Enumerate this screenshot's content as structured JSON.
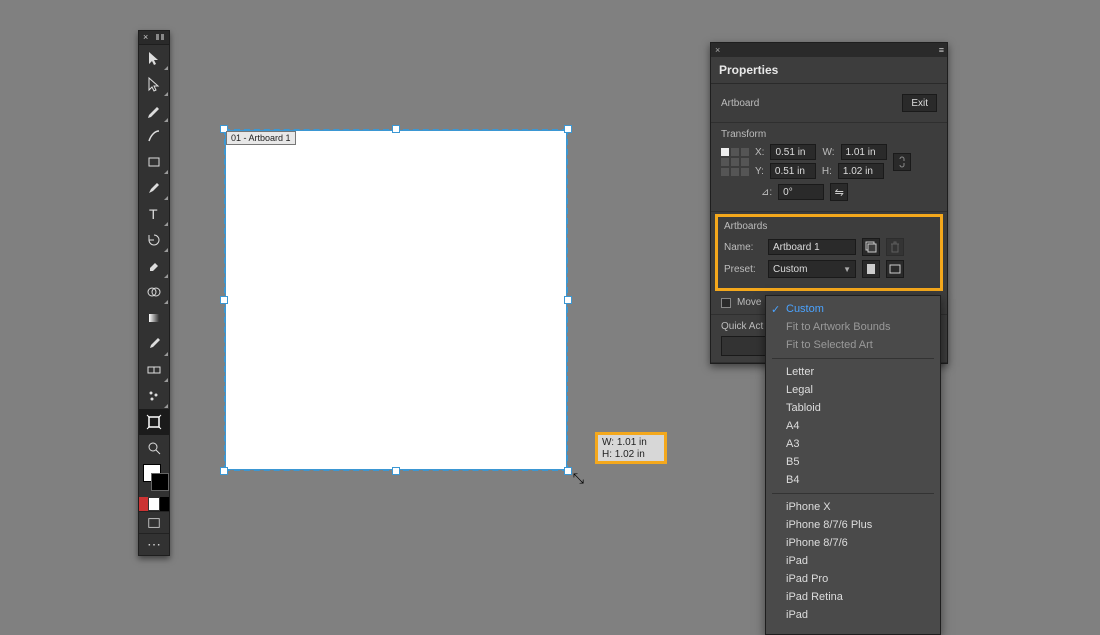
{
  "artboard": {
    "label": "01 - Artboard 1",
    "dim_tip_w": "W: 1.01 in",
    "dim_tip_h": "H: 1.02 in"
  },
  "panel": {
    "title": "Properties",
    "close_glyph": "×",
    "menu_glyph": "≡",
    "selection_type": "Artboard",
    "exit_label": "Exit",
    "transform": {
      "heading": "Transform",
      "x_label": "X:",
      "x_value": "0.51 in",
      "y_label": "Y:",
      "y_value": "0.51 in",
      "w_label": "W:",
      "w_value": "1.01 in",
      "h_label": "H:",
      "h_value": "1.02 in",
      "angle_label": "⊿:",
      "angle_value": "0°"
    },
    "artboards": {
      "heading": "Artboards",
      "name_label": "Name:",
      "name_value": "Artboard 1",
      "preset_label": "Preset:",
      "preset_value": "Custom"
    },
    "move_label": "Move",
    "quick_actions_label": "Quick Act"
  },
  "dropdown": {
    "selected": "Custom",
    "fit_artwork": "Fit to Artwork Bounds",
    "fit_selected": "Fit to Selected Art",
    "items_a": [
      "Letter",
      "Legal",
      "Tabloid",
      "A4",
      "A3",
      "B5",
      "B4"
    ],
    "items_b": [
      "iPhone X",
      "iPhone 8/7/6 Plus",
      "iPhone 8/7/6",
      "iPad",
      "iPad Pro",
      "iPad Retina",
      "iPad"
    ]
  },
  "tooltips": {}
}
